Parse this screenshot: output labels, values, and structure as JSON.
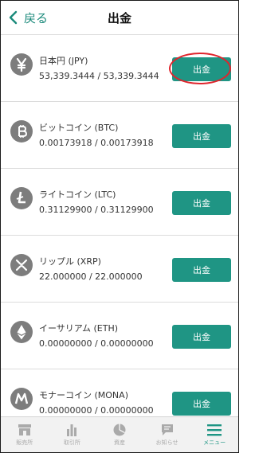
{
  "header": {
    "back_label": "戻る",
    "title": "出金"
  },
  "colors": {
    "accent": "#1f9584",
    "icon_gray": "#7d7d7d",
    "highlight": "#e0242c"
  },
  "assets": [
    {
      "icon": "yen-icon",
      "name": "日本円 (JPY)",
      "amount": "53,339.3444 / 53,339.3444",
      "button": "出金",
      "highlighted": true
    },
    {
      "icon": "bitcoin-icon",
      "name": "ビットコイン (BTC)",
      "amount": "0.00173918 / 0.00173918",
      "button": "出金",
      "highlighted": false
    },
    {
      "icon": "litecoin-icon",
      "name": "ライトコイン (LTC)",
      "amount": "0.31129900 / 0.31129900",
      "button": "出金",
      "highlighted": false
    },
    {
      "icon": "ripple-icon",
      "name": "リップル (XRP)",
      "amount": "22.000000 / 22.000000",
      "button": "出金",
      "highlighted": false
    },
    {
      "icon": "ethereum-icon",
      "name": "イーサリアム (ETH)",
      "amount": "0.00000000 / 0.00000000",
      "button": "出金",
      "highlighted": false
    },
    {
      "icon": "monacoin-icon",
      "name": "モナーコイン (MONA)",
      "amount": "0.00000000 / 0.00000000",
      "button": "出金",
      "highlighted": false
    }
  ],
  "nav": {
    "items": [
      {
        "icon": "store-icon",
        "label": "販売所"
      },
      {
        "icon": "bar-chart-icon",
        "label": "取引所"
      },
      {
        "icon": "pie-chart-icon",
        "label": "資産"
      },
      {
        "icon": "message-icon",
        "label": "お知らせ"
      },
      {
        "icon": "menu-icon",
        "label": "メニュー"
      }
    ],
    "active_index": 4
  }
}
